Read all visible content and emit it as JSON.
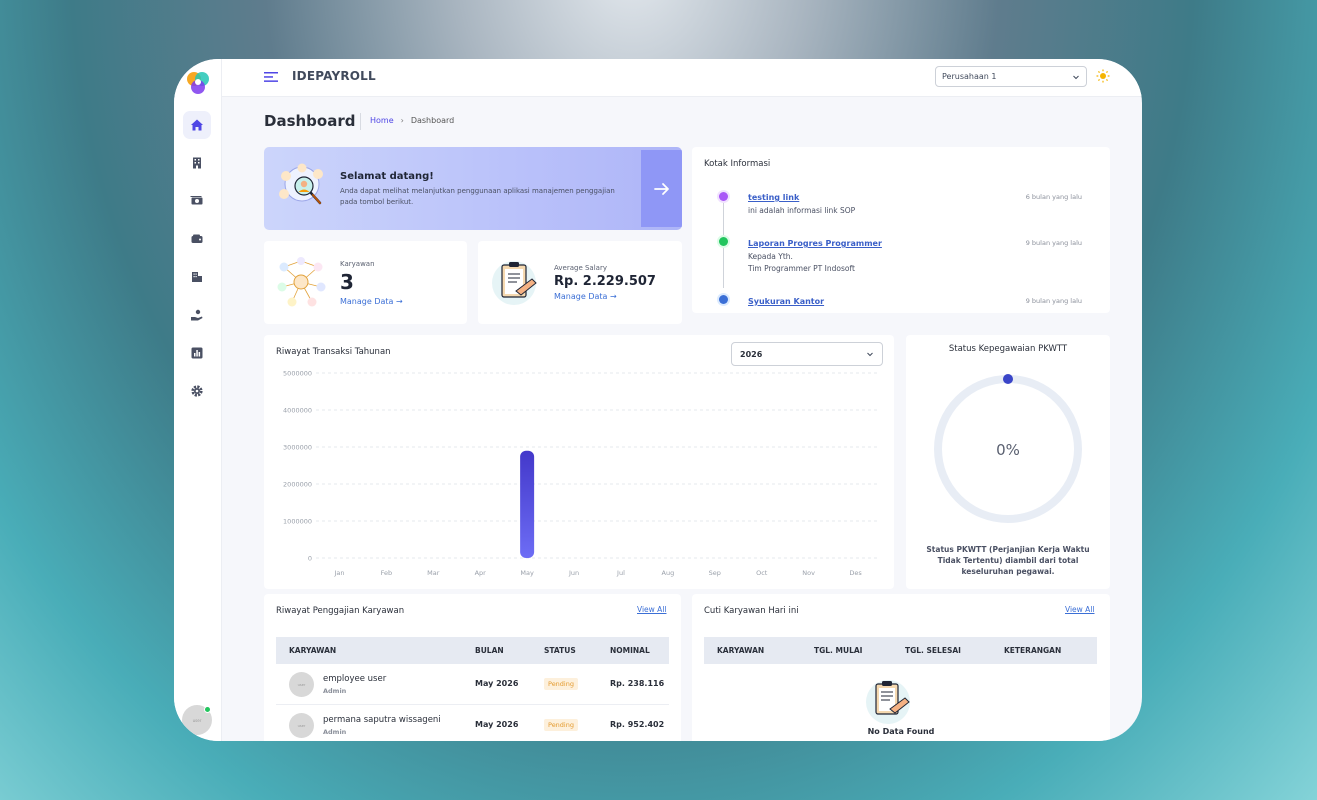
{
  "app": {
    "brand": "IDEPAYROLL",
    "company": "Perusahaan 1"
  },
  "page": {
    "title": "Dashboard",
    "breadcrumb": [
      "Home",
      "Dashboard"
    ]
  },
  "sidebar": {
    "items": [
      {
        "icon": "home-icon",
        "active": true
      },
      {
        "icon": "building-icon"
      },
      {
        "icon": "money-icon"
      },
      {
        "icon": "wallet-icon"
      },
      {
        "icon": "company-icon"
      },
      {
        "icon": "hand-coin-icon"
      },
      {
        "icon": "report-icon"
      },
      {
        "icon": "gear-icon"
      }
    ],
    "avatar_text": "user"
  },
  "welcome": {
    "title": "Selamat datang!",
    "text": "Anda dapat melihat melanjutkan penggunaan aplikasi manajemen penggajian pada tombol berikut."
  },
  "stats": {
    "employees": {
      "label": "Karyawan",
      "value": "3",
      "link": "Manage Data →"
    },
    "salary": {
      "label": "Average Salary",
      "value": "Rp. 2.229.507",
      "link": "Manage Data →"
    }
  },
  "info_box": {
    "title": "Kotak Informasi",
    "items": [
      {
        "title": "testing link",
        "body": [
          "ini adalah informasi link SOP"
        ],
        "time": "6 bulan yang lalu",
        "color": "#a855f7"
      },
      {
        "title": "Laporan Progres Programmer",
        "body": [
          "Kepada Yth.",
          "Tim Programmer PT Indosoft"
        ],
        "time": "9 bulan yang lalu",
        "color": "#22c55e"
      },
      {
        "title": "Syukuran Kantor",
        "body": [],
        "time": "9 bulan yang lalu",
        "color": "#3b6fd6"
      }
    ]
  },
  "chart_data": {
    "type": "bar",
    "title": "Riwayat Transaksi Tahunan",
    "year": "2026",
    "categories": [
      "Jan",
      "Feb",
      "Mar",
      "Apr",
      "May",
      "Jun",
      "Jul",
      "Aug",
      "Sep",
      "Oct",
      "Nov",
      "Des"
    ],
    "values": [
      0,
      0,
      0,
      0,
      2900000,
      0,
      0,
      0,
      0,
      0,
      0,
      0
    ],
    "yticks": [
      0,
      1000000,
      2000000,
      3000000,
      4000000,
      5000000
    ],
    "ylim": [
      0,
      5000000
    ],
    "grid": true,
    "bar_color": "#4338ca"
  },
  "pkwtt": {
    "title": "Status Kepegawaian PKWTT",
    "percent": 0,
    "value_label": "0%",
    "caption": "Status PKWTT (Perjanjian Kerja Waktu Tidak Tertentu) diambil dari total keseluruhan pegawai.",
    "track_color": "#e8edf5",
    "dot_color": "#3a45c8"
  },
  "payroll": {
    "title": "Riwayat Penggajian Karyawan",
    "view_all": "View All",
    "columns": [
      "KARYAWAN",
      "BULAN",
      "STATUS",
      "NOMINAL"
    ],
    "rows": [
      {
        "name": "employee user",
        "role": "Admin",
        "month": "May 2026",
        "status": "Pending",
        "amount": "Rp. 238.116",
        "avatar": "user"
      },
      {
        "name": "permana saputra wissageni",
        "role": "Admin",
        "month": "May 2026",
        "status": "Pending",
        "amount": "Rp. 952.402",
        "avatar": "user"
      }
    ]
  },
  "leave": {
    "title": "Cuti Karyawan Hari ini",
    "view_all": "View All",
    "columns": [
      "KARYAWAN",
      "TGL. MULAI",
      "TGL. SELESAI",
      "KETERANGAN"
    ],
    "empty": "No Data Found"
  }
}
